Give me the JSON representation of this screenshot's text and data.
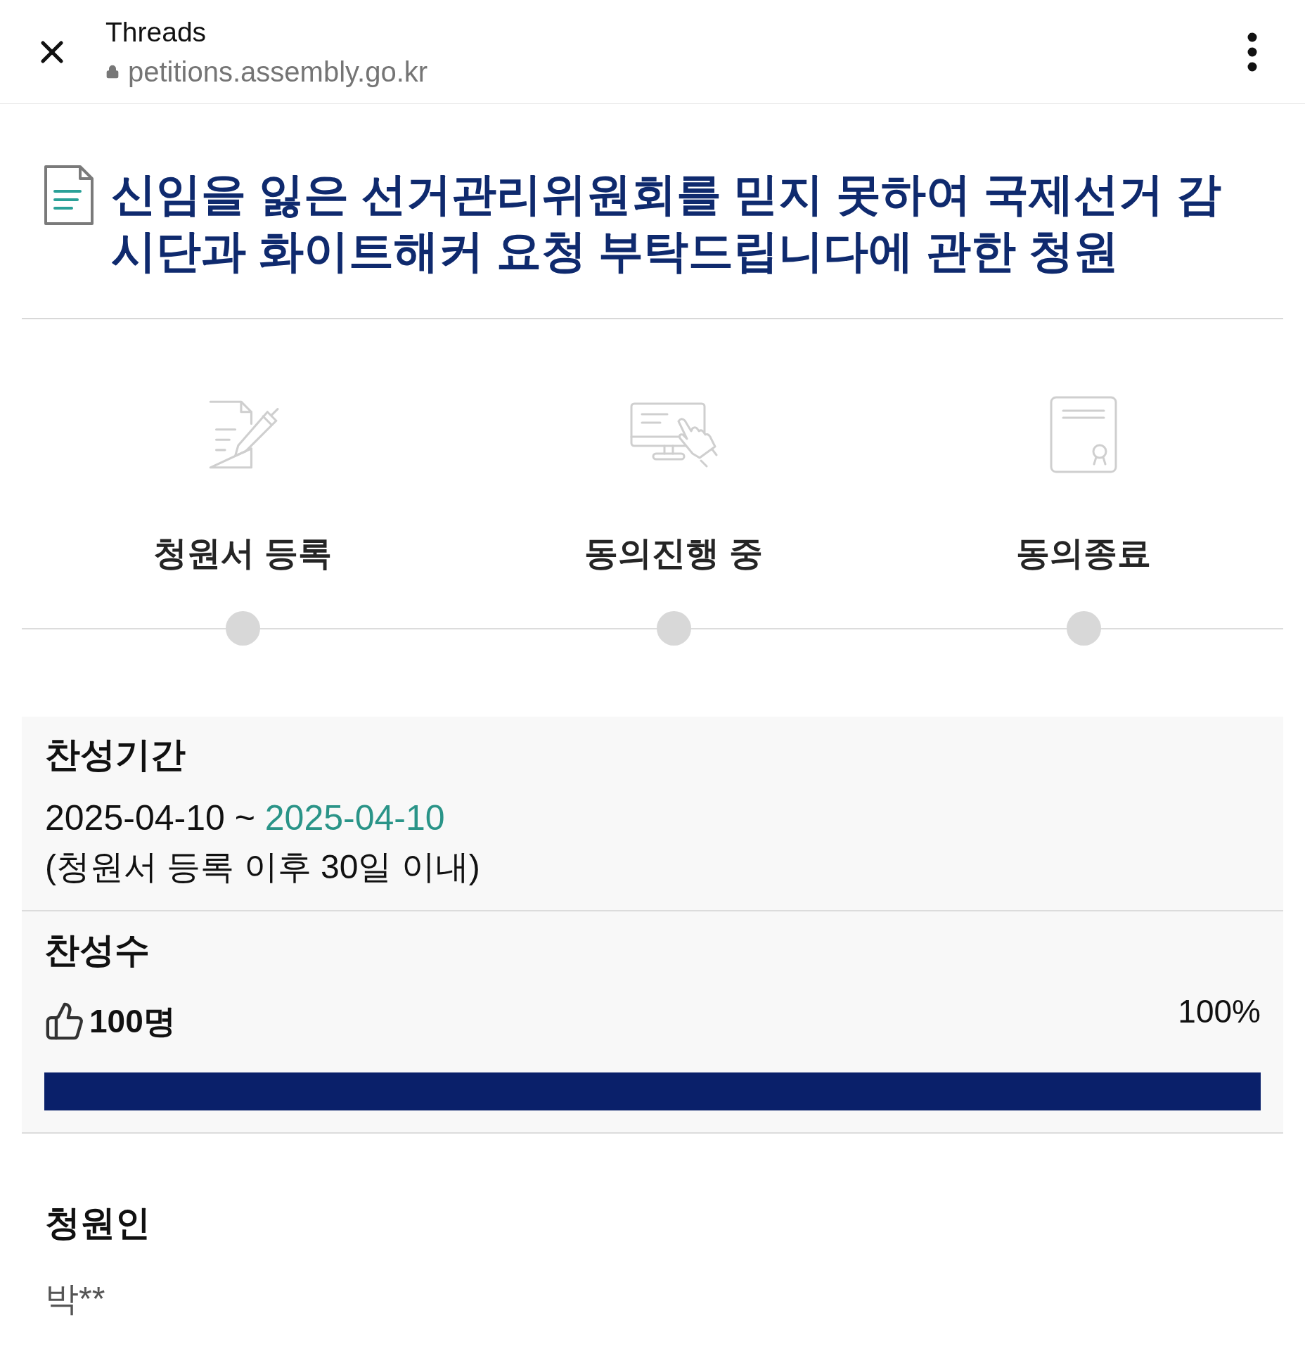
{
  "browser_bar": {
    "title": "Threads",
    "url": "petitions.assembly.go.kr"
  },
  "petition": {
    "title": "신임을 잃은 선거관리위원회를 믿지 못하여 국제선거 감시단과 화이트해커 요청 부탁드립니다에 관한 청원"
  },
  "steps": [
    {
      "label": "청원서 등록",
      "kind": "register"
    },
    {
      "label": "동의진행 중",
      "kind": "progress"
    },
    {
      "label": "동의종료",
      "kind": "closed"
    }
  ],
  "period": {
    "heading": "찬성기간",
    "start": "2025-04-10",
    "separator": "~",
    "end": "2025-04-10",
    "note": "(청원서 등록 이후 30일 이내)"
  },
  "votes": {
    "heading": "찬성수",
    "count": "100명",
    "percent": "100%",
    "level": 1
  },
  "petitioner": {
    "heading": "청원인",
    "name": "박**"
  }
}
